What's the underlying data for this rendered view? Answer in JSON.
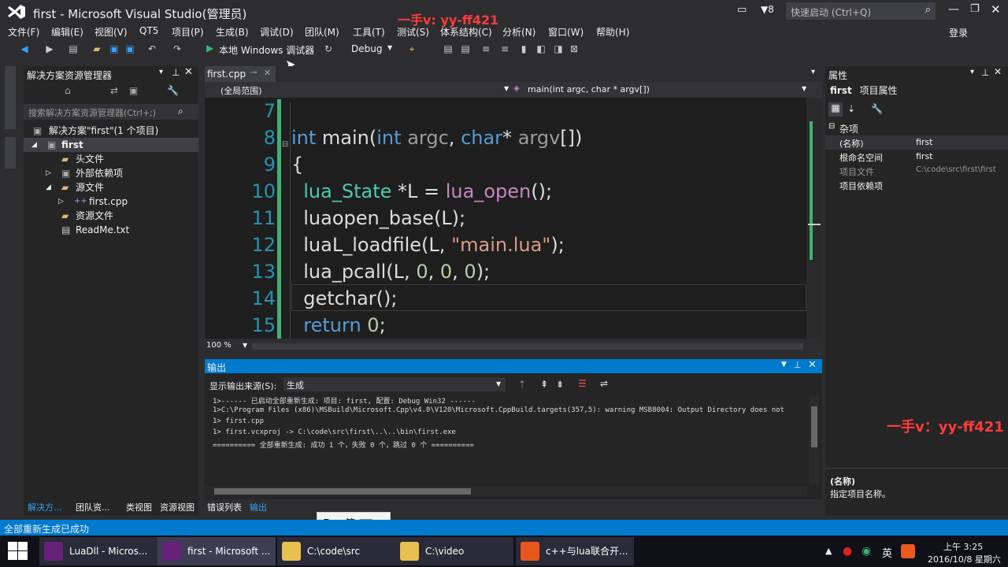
{
  "window": {
    "title": "first - Microsoft Visual Studio(管理员)",
    "watermark": "一手v: yy-ff421",
    "watermark2": "一手v：yy-ff421",
    "quick_launch_placeholder": "快速启动 (Ctrl+Q)",
    "login": "登录",
    "notif_count": "8"
  },
  "menu": [
    "文件(F)",
    "编辑(E)",
    "视图(V)",
    "QT5",
    "项目(P)",
    "生成(B)",
    "调试(D)",
    "团队(M)",
    "工具(T)",
    "测试(S)",
    "体系结构(C)",
    "分析(N)",
    "窗口(W)",
    "帮助(H)"
  ],
  "toolbar": {
    "run_label": "本地 Windows 调试器",
    "config": "Debug"
  },
  "solution_explorer": {
    "title": "解决方案资源管理器",
    "search_placeholder": "搜索解决方案资源管理器(Ctrl+;)",
    "items": [
      {
        "label": "解决方案\"first\"(1 个项目)"
      },
      {
        "label": "first"
      },
      {
        "label": "头文件"
      },
      {
        "label": "外部依赖项"
      },
      {
        "label": "源文件"
      },
      {
        "label": "first.cpp"
      },
      {
        "label": "资源文件"
      },
      {
        "label": "ReadMe.txt"
      }
    ]
  },
  "editor": {
    "tab": "first.cpp",
    "scope": "(全局范围)",
    "member": "main(int argc, char * argv[])",
    "zoom": "100 %",
    "lines": [
      "7",
      "8",
      "9",
      "10",
      "11",
      "12",
      "13",
      "14",
      "15"
    ]
  },
  "output": {
    "title": "输出",
    "source_label": "显示输出来源(S):",
    "source_value": "生成",
    "lines": [
      "1>------ 已启动全部重新生成:  项目: first, 配置: Debug Win32 ------",
      "1>C:\\Program Files (x86)\\MSBuild\\Microsoft.Cpp\\v4.0\\V120\\Microsoft.CppBuild.targets(357,5): warning MSB8004: Output Directory does not",
      "1>  first.cpp",
      "1>  first.vcxproj -> C:\\code\\src\\first\\..\\..\\bin\\first.exe",
      "========== 全部重新生成:  成功 1 个，失败 0 个，跳过 0 个 =========="
    ]
  },
  "properties": {
    "title": "属性",
    "object": "first",
    "object_type": "项目属性",
    "category": "杂项",
    "rows": [
      {
        "k": "(名称)",
        "v": "first"
      },
      {
        "k": "根命名空间",
        "v": "first"
      },
      {
        "k": "项目文件",
        "v": "C:\\code\\src\\first\\first"
      },
      {
        "k": "项目依赖项",
        "v": ""
      }
    ],
    "desc_title": "(名称)",
    "desc_text": "指定项目名称。"
  },
  "bottom_tabs": [
    "解决方...",
    "团队资...",
    "类视图",
    "资源视图",
    "错误列表",
    "输出"
  ],
  "status": "全部重新生成已成功",
  "ime": "E •, 简 ⌨ ◗",
  "taskbar": {
    "items": [
      "LuaDll - Micros...",
      "first - Microsoft ...",
      "C:\\code\\src",
      "C:\\video",
      "c++与lua联合开..."
    ],
    "time": "上午 3:25",
    "date": "2016/10/8 星期六",
    "lang": "英"
  }
}
